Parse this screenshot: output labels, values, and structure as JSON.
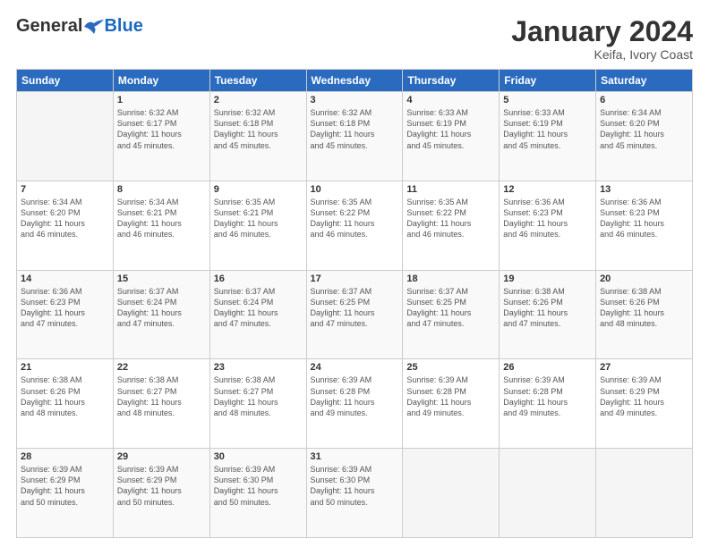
{
  "header": {
    "logo": {
      "general": "General",
      "blue": "Blue"
    },
    "title": "January 2024",
    "location": "Keifa, Ivory Coast"
  },
  "weekdays": [
    "Sunday",
    "Monday",
    "Tuesday",
    "Wednesday",
    "Thursday",
    "Friday",
    "Saturday"
  ],
  "weeks": [
    [
      {
        "day": "",
        "info": ""
      },
      {
        "day": "1",
        "info": "Sunrise: 6:32 AM\nSunset: 6:17 PM\nDaylight: 11 hours\nand 45 minutes."
      },
      {
        "day": "2",
        "info": "Sunrise: 6:32 AM\nSunset: 6:18 PM\nDaylight: 11 hours\nand 45 minutes."
      },
      {
        "day": "3",
        "info": "Sunrise: 6:32 AM\nSunset: 6:18 PM\nDaylight: 11 hours\nand 45 minutes."
      },
      {
        "day": "4",
        "info": "Sunrise: 6:33 AM\nSunset: 6:19 PM\nDaylight: 11 hours\nand 45 minutes."
      },
      {
        "day": "5",
        "info": "Sunrise: 6:33 AM\nSunset: 6:19 PM\nDaylight: 11 hours\nand 45 minutes."
      },
      {
        "day": "6",
        "info": "Sunrise: 6:34 AM\nSunset: 6:20 PM\nDaylight: 11 hours\nand 45 minutes."
      }
    ],
    [
      {
        "day": "7",
        "info": "Sunrise: 6:34 AM\nSunset: 6:20 PM\nDaylight: 11 hours\nand 46 minutes."
      },
      {
        "day": "8",
        "info": "Sunrise: 6:34 AM\nSunset: 6:21 PM\nDaylight: 11 hours\nand 46 minutes."
      },
      {
        "day": "9",
        "info": "Sunrise: 6:35 AM\nSunset: 6:21 PM\nDaylight: 11 hours\nand 46 minutes."
      },
      {
        "day": "10",
        "info": "Sunrise: 6:35 AM\nSunset: 6:22 PM\nDaylight: 11 hours\nand 46 minutes."
      },
      {
        "day": "11",
        "info": "Sunrise: 6:35 AM\nSunset: 6:22 PM\nDaylight: 11 hours\nand 46 minutes."
      },
      {
        "day": "12",
        "info": "Sunrise: 6:36 AM\nSunset: 6:23 PM\nDaylight: 11 hours\nand 46 minutes."
      },
      {
        "day": "13",
        "info": "Sunrise: 6:36 AM\nSunset: 6:23 PM\nDaylight: 11 hours\nand 46 minutes."
      }
    ],
    [
      {
        "day": "14",
        "info": "Sunrise: 6:36 AM\nSunset: 6:23 PM\nDaylight: 11 hours\nand 47 minutes."
      },
      {
        "day": "15",
        "info": "Sunrise: 6:37 AM\nSunset: 6:24 PM\nDaylight: 11 hours\nand 47 minutes."
      },
      {
        "day": "16",
        "info": "Sunrise: 6:37 AM\nSunset: 6:24 PM\nDaylight: 11 hours\nand 47 minutes."
      },
      {
        "day": "17",
        "info": "Sunrise: 6:37 AM\nSunset: 6:25 PM\nDaylight: 11 hours\nand 47 minutes."
      },
      {
        "day": "18",
        "info": "Sunrise: 6:37 AM\nSunset: 6:25 PM\nDaylight: 11 hours\nand 47 minutes."
      },
      {
        "day": "19",
        "info": "Sunrise: 6:38 AM\nSunset: 6:26 PM\nDaylight: 11 hours\nand 47 minutes."
      },
      {
        "day": "20",
        "info": "Sunrise: 6:38 AM\nSunset: 6:26 PM\nDaylight: 11 hours\nand 48 minutes."
      }
    ],
    [
      {
        "day": "21",
        "info": "Sunrise: 6:38 AM\nSunset: 6:26 PM\nDaylight: 11 hours\nand 48 minutes."
      },
      {
        "day": "22",
        "info": "Sunrise: 6:38 AM\nSunset: 6:27 PM\nDaylight: 11 hours\nand 48 minutes."
      },
      {
        "day": "23",
        "info": "Sunrise: 6:38 AM\nSunset: 6:27 PM\nDaylight: 11 hours\nand 48 minutes."
      },
      {
        "day": "24",
        "info": "Sunrise: 6:39 AM\nSunset: 6:28 PM\nDaylight: 11 hours\nand 49 minutes."
      },
      {
        "day": "25",
        "info": "Sunrise: 6:39 AM\nSunset: 6:28 PM\nDaylight: 11 hours\nand 49 minutes."
      },
      {
        "day": "26",
        "info": "Sunrise: 6:39 AM\nSunset: 6:28 PM\nDaylight: 11 hours\nand 49 minutes."
      },
      {
        "day": "27",
        "info": "Sunrise: 6:39 AM\nSunset: 6:29 PM\nDaylight: 11 hours\nand 49 minutes."
      }
    ],
    [
      {
        "day": "28",
        "info": "Sunrise: 6:39 AM\nSunset: 6:29 PM\nDaylight: 11 hours\nand 50 minutes."
      },
      {
        "day": "29",
        "info": "Sunrise: 6:39 AM\nSunset: 6:29 PM\nDaylight: 11 hours\nand 50 minutes."
      },
      {
        "day": "30",
        "info": "Sunrise: 6:39 AM\nSunset: 6:30 PM\nDaylight: 11 hours\nand 50 minutes."
      },
      {
        "day": "31",
        "info": "Sunrise: 6:39 AM\nSunset: 6:30 PM\nDaylight: 11 hours\nand 50 minutes."
      },
      {
        "day": "",
        "info": ""
      },
      {
        "day": "",
        "info": ""
      },
      {
        "day": "",
        "info": ""
      }
    ]
  ]
}
